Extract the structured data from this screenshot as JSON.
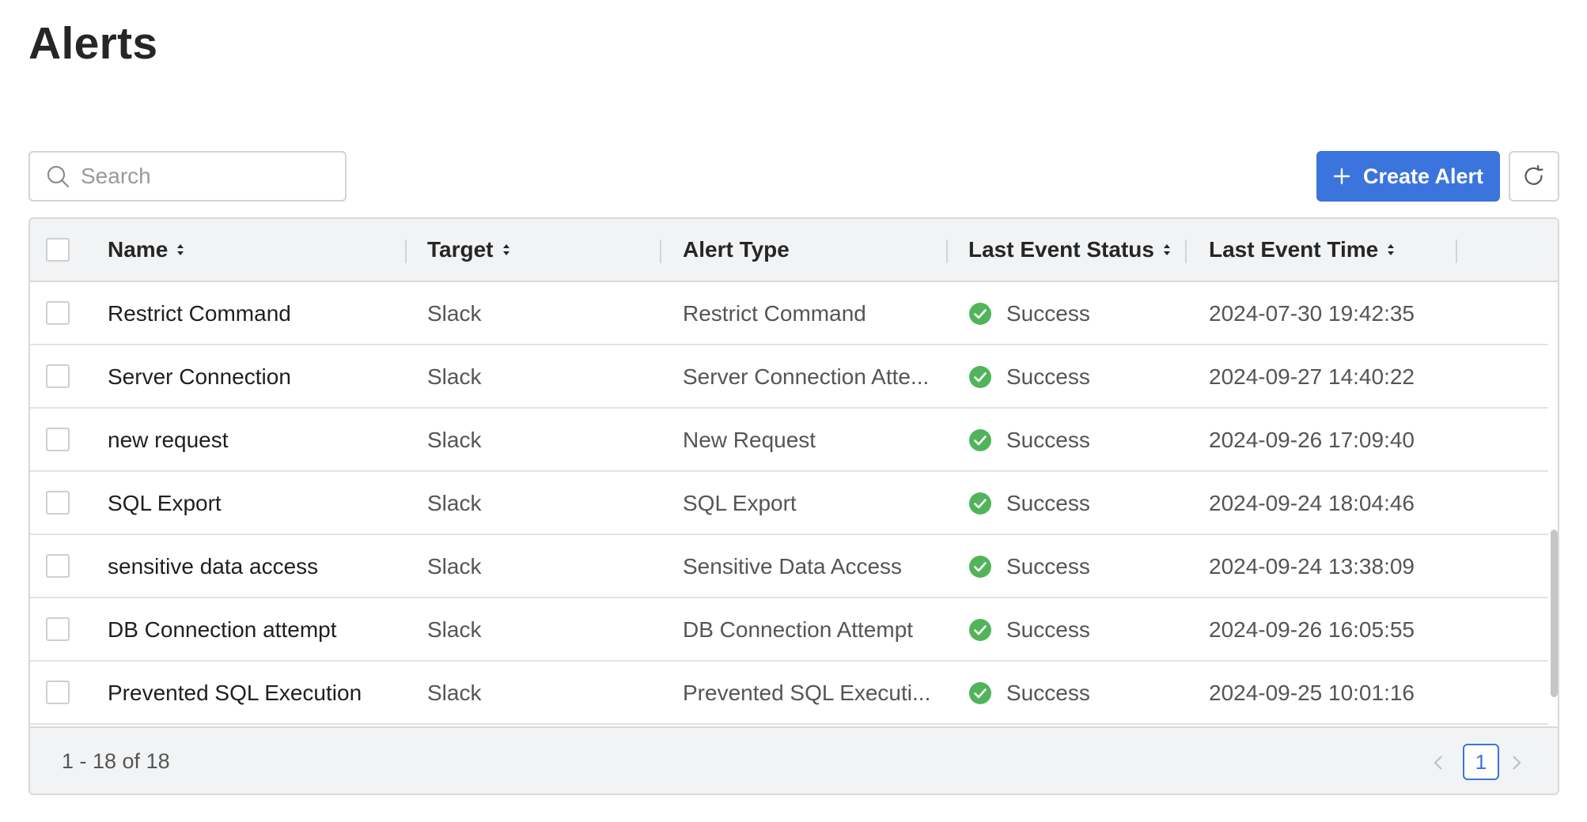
{
  "page": {
    "title": "Alerts"
  },
  "toolbar": {
    "search_placeholder": "Search",
    "search_value": "",
    "create_label": "Create Alert",
    "accent_color": "#3b74dd"
  },
  "table": {
    "columns": [
      {
        "key": "name",
        "label": "Name",
        "sortable": true
      },
      {
        "key": "target",
        "label": "Target",
        "sortable": true
      },
      {
        "key": "alert_type",
        "label": "Alert Type",
        "sortable": false
      },
      {
        "key": "status",
        "label": "Last Event Status",
        "sortable": true
      },
      {
        "key": "time",
        "label": "Last Event Time",
        "sortable": true
      }
    ],
    "rows": [
      {
        "name": "Restrict Command",
        "target": "Slack",
        "alert_type": "Restrict Command",
        "status": "Success",
        "time": "2024-07-30 19:42:35"
      },
      {
        "name": "Server Connection",
        "target": "Slack",
        "alert_type": "Server Connection Atte...",
        "status": "Success",
        "time": "2024-09-27 14:40:22"
      },
      {
        "name": "new request",
        "target": "Slack",
        "alert_type": "New Request",
        "status": "Success",
        "time": "2024-09-26 17:09:40"
      },
      {
        "name": "SQL Export",
        "target": "Slack",
        "alert_type": "SQL Export",
        "status": "Success",
        "time": "2024-09-24 18:04:46"
      },
      {
        "name": "sensitive data access",
        "target": "Slack",
        "alert_type": "Sensitive Data Access",
        "status": "Success",
        "time": "2024-09-24 13:38:09"
      },
      {
        "name": "DB Connection attempt",
        "target": "Slack",
        "alert_type": "DB Connection Attempt",
        "status": "Success",
        "time": "2024-09-26 16:05:55"
      },
      {
        "name": "Prevented SQL Execution",
        "target": "Slack",
        "alert_type": "Prevented SQL Executi...",
        "status": "Success",
        "time": "2024-09-25 10:01:16"
      }
    ],
    "status_color": "#52b45a"
  },
  "pagination": {
    "range_text": "1 - 18 of 18",
    "current_page": "1"
  }
}
